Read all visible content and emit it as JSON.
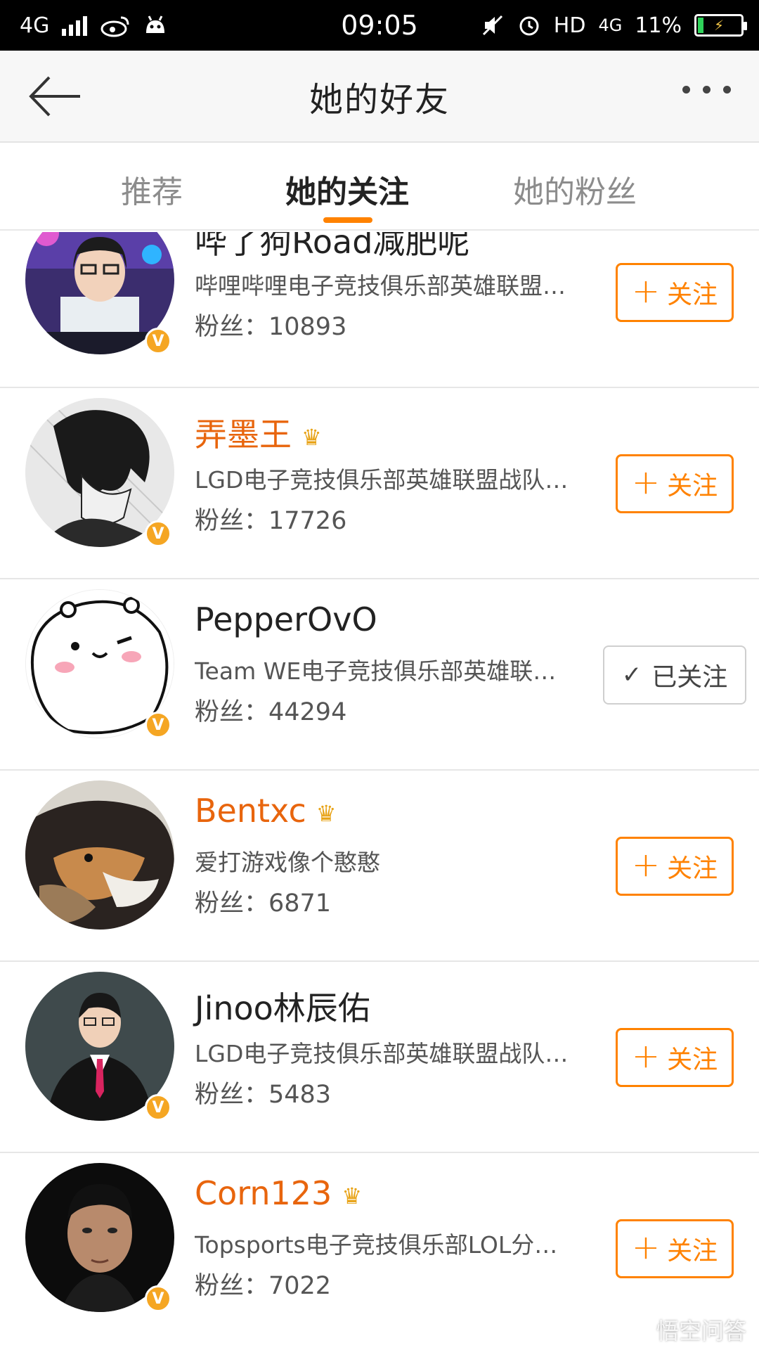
{
  "status_bar": {
    "network": "4G",
    "time": "09:05",
    "hd": "HD",
    "net_right": "4G",
    "battery": "11%"
  },
  "header": {
    "title": "她的好友"
  },
  "tabs": [
    {
      "label": "推荐",
      "active": false
    },
    {
      "label": "她的关注",
      "active": true
    },
    {
      "label": "她的粉丝",
      "active": false
    }
  ],
  "follow_label": "关注",
  "followed_label": "已关注",
  "users": [
    {
      "name": "哔了狗Road减肥呢",
      "vip": false,
      "desc": "哔哩哔哩电子竞技俱乐部英雄联盟…",
      "fans": "粉丝：10893",
      "followed": false
    },
    {
      "name": "弄墨王",
      "vip": true,
      "desc": "LGD电子竞技俱乐部英雄联盟战队…",
      "fans": "粉丝：17726",
      "followed": false
    },
    {
      "name": "PepperOvO",
      "vip": false,
      "desc": "Team WE电子竞技俱乐部英雄联…",
      "fans": "粉丝：44294",
      "followed": true
    },
    {
      "name": "Bentxc",
      "vip": true,
      "desc": "爱打游戏像个憨憨",
      "fans": "粉丝：6871",
      "followed": false
    },
    {
      "name": "Jinoo林辰佑",
      "vip": false,
      "desc": "LGD电子竞技俱乐部英雄联盟战队…",
      "fans": "粉丝：5483",
      "followed": false
    },
    {
      "name": "Corn123",
      "vip": true,
      "desc": "Topsports电子竞技俱乐部LOL分…",
      "fans": "粉丝：7022",
      "followed": false
    }
  ],
  "verified_badge": "V",
  "watermark": "悟空问答",
  "colors": {
    "accent": "#ff8200",
    "vip_name": "#e8650d",
    "badge": "#f5a623"
  }
}
